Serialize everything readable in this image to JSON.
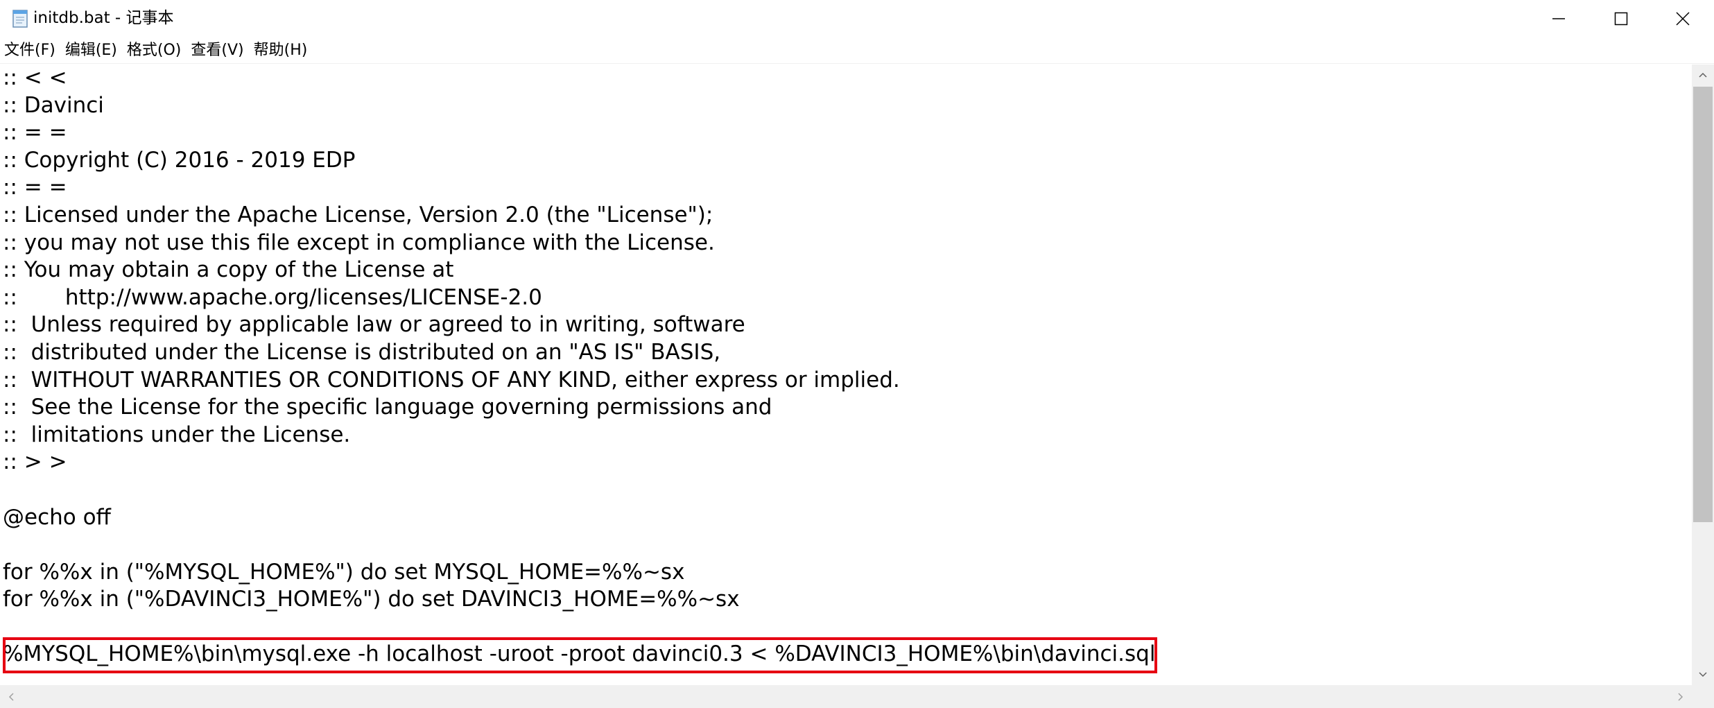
{
  "window": {
    "title": "initdb.bat - 记事本",
    "icon": "notepad-icon"
  },
  "controls": {
    "minimize_icon": "minimize-icon",
    "maximize_icon": "maximize-icon",
    "close_icon": "close-icon"
  },
  "menu": {
    "items": [
      {
        "label": "文件(F)"
      },
      {
        "label": "编辑(E)"
      },
      {
        "label": "格式(O)"
      },
      {
        "label": "查看(V)"
      },
      {
        "label": "帮助(H)"
      }
    ]
  },
  "editor": {
    "lines": [
      ":: < <",
      ":: Davinci",
      ":: = =",
      ":: Copyright (C) 2016 - 2019 EDP",
      ":: = =",
      ":: Licensed under the Apache License, Version 2.0 (the \"License\");",
      ":: you may not use this file except in compliance with the License.",
      ":: You may obtain a copy of the License at",
      "::       http://www.apache.org/licenses/LICENSE-2.0",
      "::  Unless required by applicable law or agreed to in writing, software",
      "::  distributed under the License is distributed on an \"AS IS\" BASIS,",
      "::  WITHOUT WARRANTIES OR CONDITIONS OF ANY KIND, either express or implied.",
      "::  See the License for the specific language governing permissions and",
      "::  limitations under the License.",
      ":: > >",
      "",
      "@echo off",
      "",
      "for %%x in (\"%MYSQL_HOME%\") do set MYSQL_HOME=%%~sx",
      "for %%x in (\"%DAVINCI3_HOME%\") do set DAVINCI3_HOME=%%~sx",
      "",
      "%MYSQL_HOME%\\bin\\mysql.exe -h localhost -uroot -proot davinci0.3 < %DAVINCI3_HOME%\\bin\\davinci.sql"
    ],
    "highlighted_line_index": 21,
    "highlight_color": "#e60012"
  }
}
